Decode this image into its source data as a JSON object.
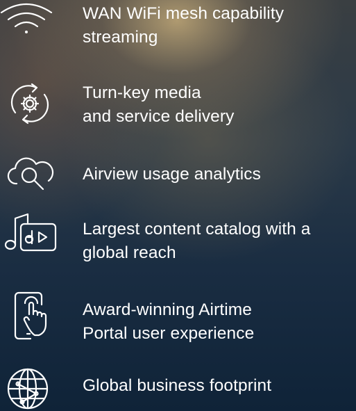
{
  "features": [
    {
      "icon": "wifi-icon",
      "lines": [
        "WAN WiFi mesh capability",
        "streaming"
      ]
    },
    {
      "icon": "gear-refresh-icon",
      "lines": [
        "Turn-key media",
        "and service delivery"
      ]
    },
    {
      "icon": "cloud-search-icon",
      "lines": [
        "Airview usage analytics"
      ]
    },
    {
      "icon": "music-video-icon",
      "lines": [
        "Largest content catalog with a",
        "global reach"
      ]
    },
    {
      "icon": "tablet-touch-icon",
      "lines": [
        "Award-winning Airtime",
        "Portal user experience"
      ]
    },
    {
      "icon": "globe-icon",
      "lines": [
        "Global business footprint"
      ]
    }
  ],
  "colors": {
    "text": "#ffffff",
    "icon_stroke": "#ffffff",
    "background_top": "#3a3f42",
    "background_bottom": "#0f2338"
  }
}
